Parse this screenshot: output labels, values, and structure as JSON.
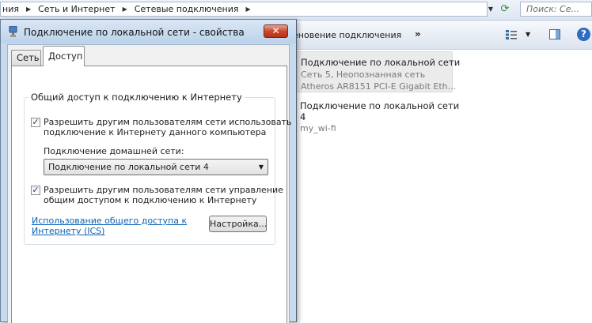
{
  "explorer": {
    "breadcrumbs": [
      "ния",
      "Сеть и Интернет",
      "Сетевые подключения"
    ],
    "search_placeholder": "Поиск: Се...",
    "command_label": "еновение подключения",
    "more_label": "»",
    "help_label": "?",
    "connections": [
      {
        "name": "Подключение по локальной сети",
        "status": "Сеть  5, Неопознанная сеть",
        "device": "Atheros AR8151 PCI-E Gigabit Eth..."
      },
      {
        "name": "Подключение по локальной сети",
        "name_line2": "4",
        "status": "my_wi-fi"
      }
    ]
  },
  "dialog": {
    "title": "Подключение по локальной сети - свойства",
    "close_label": "✕",
    "tabs": [
      {
        "label": "Сеть"
      },
      {
        "label": "Доступ"
      }
    ],
    "group_title": "Общий доступ к подключению к Интернету",
    "allow_share": {
      "checked": true,
      "line1": "Разрешить другим пользователям сети использовать",
      "line2": "подключение к Интернету данного компьютера"
    },
    "home_network_label": "Подключение домашней сети:",
    "home_network_value": "Подключение по локальной сети 4",
    "allow_control": {
      "checked": true,
      "line1": "Разрешить другим пользователям сети управление",
      "line2": "общим доступом к подключению к Интернету"
    },
    "ics_link_line1": "Использование общего доступа к",
    "ics_link_line2": "Интернету (ICS)",
    "settings_button": "Настройка..."
  },
  "colors": {
    "link": "#0b62b4",
    "close_button": "#c9482f",
    "dialog_frame": "#c8daee"
  }
}
